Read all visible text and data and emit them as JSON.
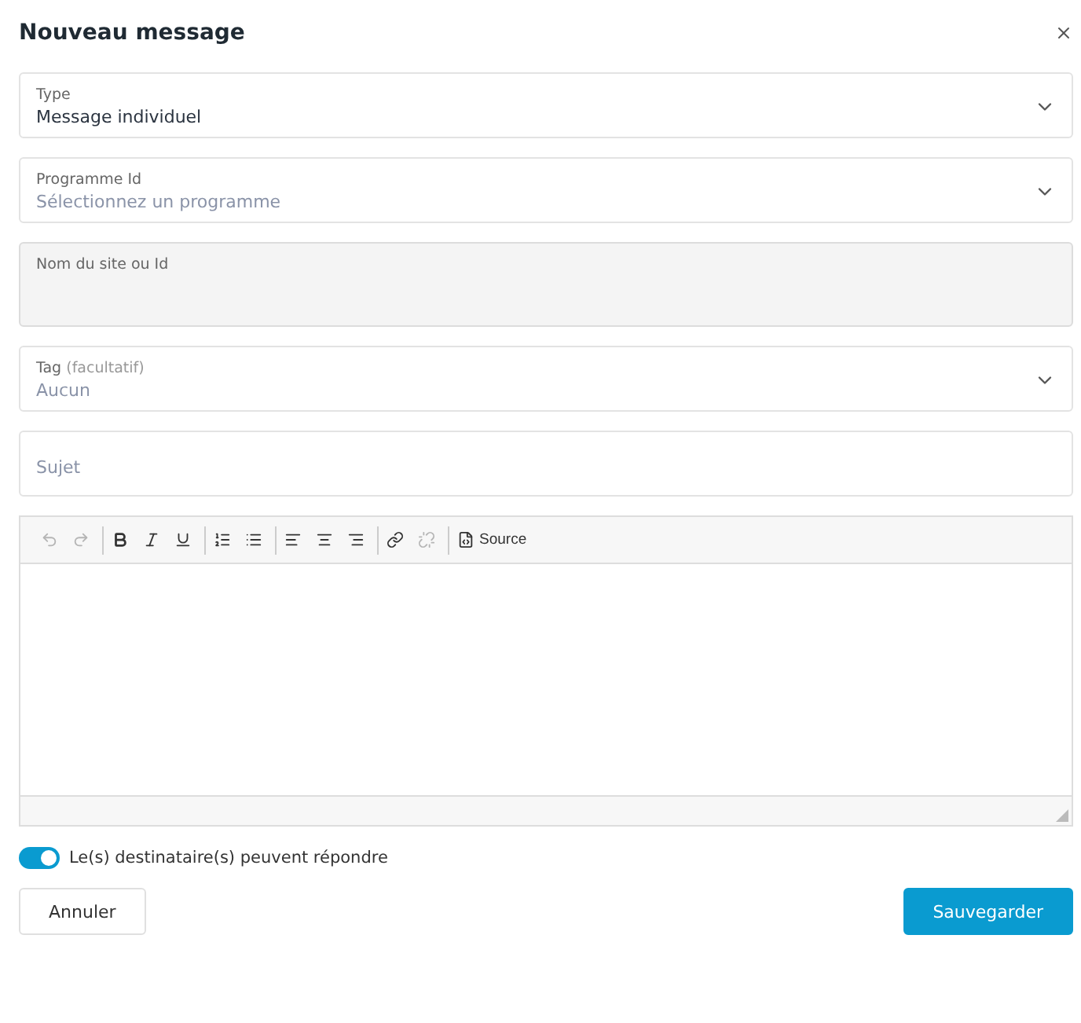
{
  "dialog": {
    "title": "Nouveau message"
  },
  "fields": [
    {
      "kind": "select",
      "label": "Type",
      "value": "Message individuel",
      "disabled": false
    },
    {
      "kind": "select",
      "label": "Programme Id",
      "placeholder": "Sélectionnez un programme",
      "disabled": false
    },
    {
      "kind": "tall",
      "label": "Nom du site ou Id",
      "disabled": true
    },
    {
      "kind": "select",
      "label": "Tag",
      "hint": "(facultatif)",
      "placeholder": "Aucun",
      "disabled": false
    },
    {
      "kind": "text",
      "placeholder": "Sujet",
      "disabled": false
    }
  ],
  "editor": {
    "toolbar": [
      [
        {
          "kind": "undo",
          "disabled": true
        },
        {
          "kind": "redo",
          "disabled": true
        }
      ],
      [
        {
          "kind": "bold",
          "disabled": false
        },
        {
          "kind": "italic",
          "disabled": false
        },
        {
          "kind": "underline",
          "disabled": false
        }
      ],
      [
        {
          "kind": "ordered-list",
          "disabled": false
        },
        {
          "kind": "bullet-list",
          "disabled": false
        }
      ],
      [
        {
          "kind": "align-left",
          "disabled": false
        },
        {
          "kind": "align-center",
          "disabled": false
        },
        {
          "kind": "align-right",
          "disabled": false
        }
      ],
      [
        {
          "kind": "link",
          "disabled": false
        },
        {
          "kind": "unlink",
          "disabled": true
        }
      ],
      [
        {
          "kind": "source",
          "label": "Source",
          "disabled": false
        }
      ]
    ]
  },
  "reply_toggle": {
    "label": "Le(s) destinataire(s) peuvent répondre",
    "on": true
  },
  "buttons": [
    {
      "kind": "secondary",
      "label": "Annuler"
    },
    {
      "kind": "primary",
      "label": "Sauvegarder"
    }
  ]
}
